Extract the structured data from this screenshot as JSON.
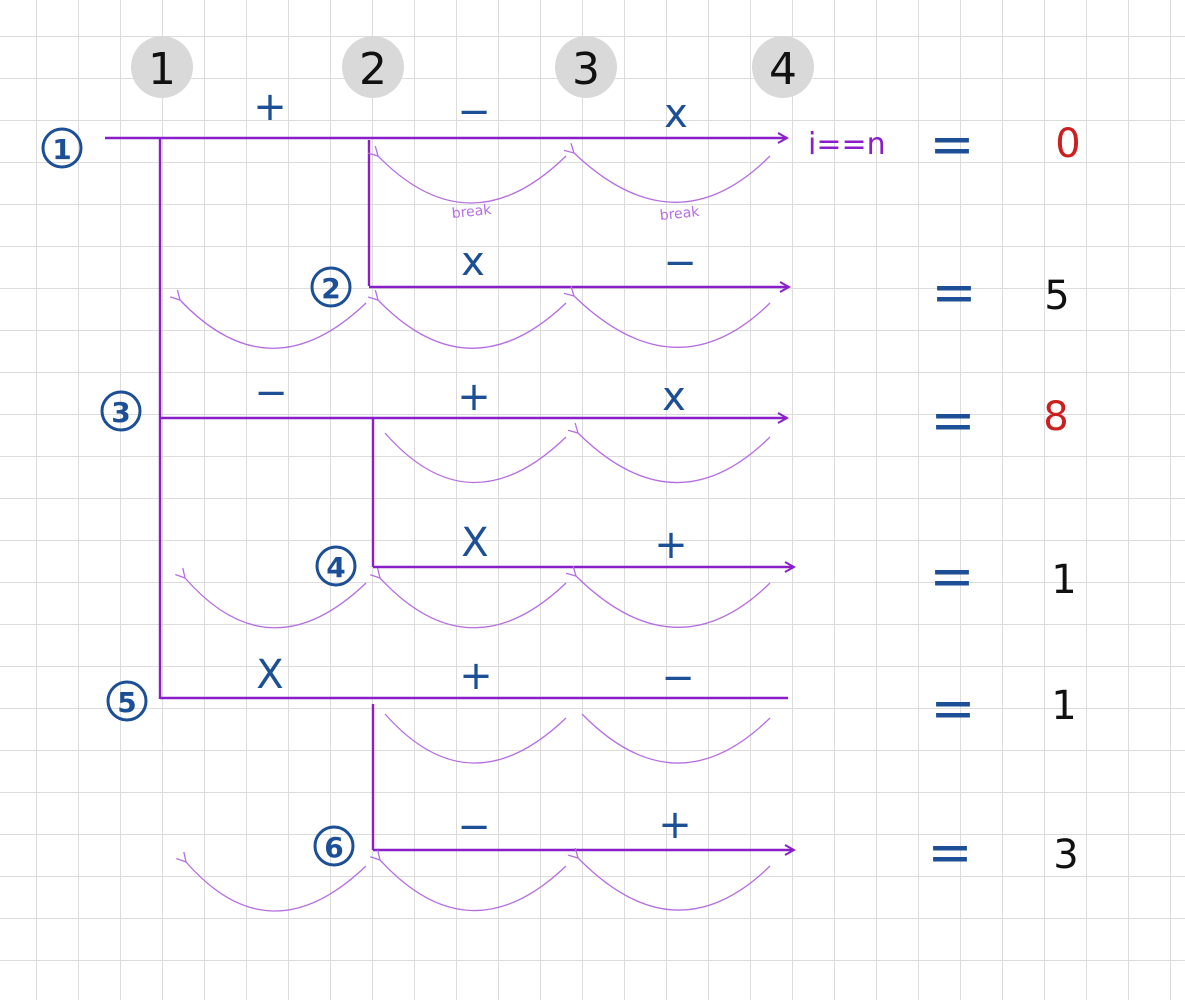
{
  "colors": {
    "line": "#8a1fc9",
    "arc": "#b56ee0",
    "ink_blue": "#1c4f96",
    "ink_red": "#cc1f1f",
    "ink_black": "#111111",
    "badge_bg": "#d9d9d9"
  },
  "columns": [
    "1",
    "2",
    "3",
    "4"
  ],
  "end_label": "i==n",
  "break_label": "break",
  "equals": "=",
  "rows": [
    {
      "num": "1",
      "ops": [
        "+",
        "−",
        "x"
      ],
      "result": "0",
      "result_color": "red"
    },
    {
      "num": "2",
      "ops": [
        "x",
        "−"
      ],
      "result": "5",
      "result_color": "black"
    },
    {
      "num": "3",
      "ops": [
        "−",
        "+",
        "x"
      ],
      "result": "8",
      "result_color": "red"
    },
    {
      "num": "4",
      "ops": [
        "X",
        "+"
      ],
      "result": "1",
      "result_color": "black"
    },
    {
      "num": "5",
      "ops": [
        "X",
        "+",
        "−"
      ],
      "result": "1",
      "result_color": "black"
    },
    {
      "num": "6",
      "ops": [
        "−",
        "+"
      ],
      "result": "3",
      "result_color": "black"
    }
  ]
}
